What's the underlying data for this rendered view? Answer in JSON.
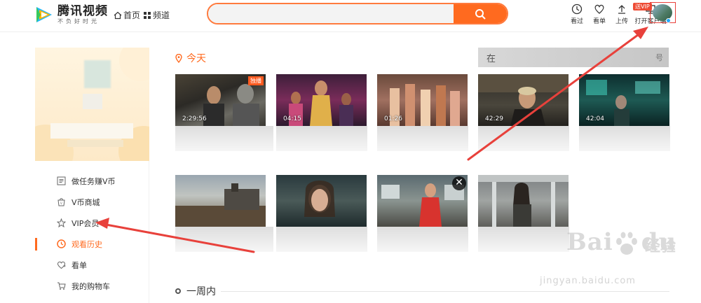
{
  "header": {
    "logo_name": "腾讯视频",
    "logo_slogan": "不负好时光",
    "nav": [
      {
        "label": "首页",
        "icon": "home-icon"
      },
      {
        "label": "频道",
        "icon": "grid-icon"
      }
    ],
    "search": {
      "placeholder": "",
      "value": ""
    },
    "tools": [
      {
        "label": "看过",
        "icon": "clock-icon"
      },
      {
        "label": "看单",
        "icon": "heart-icon"
      },
      {
        "label": "上传",
        "icon": "upload-icon"
      },
      {
        "label": "打开客户端",
        "icon": "client-icon"
      }
    ],
    "vip_tag": "送VIP"
  },
  "sidebar": {
    "menu": [
      {
        "label": "做任务赚V币",
        "icon": "task-icon",
        "active": false
      },
      {
        "label": "V币商城",
        "icon": "shop-icon",
        "active": false
      },
      {
        "label": "VIP会员",
        "icon": "vip-star-icon",
        "active": false
      },
      {
        "label": "观看历史",
        "icon": "history-clock-icon",
        "active": true
      },
      {
        "label": "看单",
        "icon": "heart-plus-icon",
        "active": false
      },
      {
        "label": "我的购物车",
        "icon": "cart-icon",
        "active": false
      }
    ]
  },
  "main": {
    "today_title": "今天",
    "week_title": "一周内",
    "grey_bar_left": "在",
    "grey_bar_right": "号",
    "row1": [
      {
        "duration": "2:29:56",
        "badge": "独播"
      },
      {
        "duration": "04:15",
        "badge": ""
      },
      {
        "duration": "01:26",
        "badge": ""
      },
      {
        "duration": "42:29",
        "badge": ""
      },
      {
        "duration": "42:04",
        "badge": ""
      }
    ],
    "row2": [
      {
        "duration": "",
        "badge": ""
      },
      {
        "duration": "",
        "badge": ""
      },
      {
        "duration": "",
        "badge": "",
        "closable": true
      },
      {
        "duration": "",
        "badge": ""
      }
    ],
    "close_glyph": "✕"
  },
  "watermark": {
    "brand": "Bai",
    "brand2": "du",
    "cn": "经验",
    "url": "jingyan.baidu.com"
  },
  "colors": {
    "accent": "#ff6a1f",
    "annotation_red": "#e8413b"
  }
}
